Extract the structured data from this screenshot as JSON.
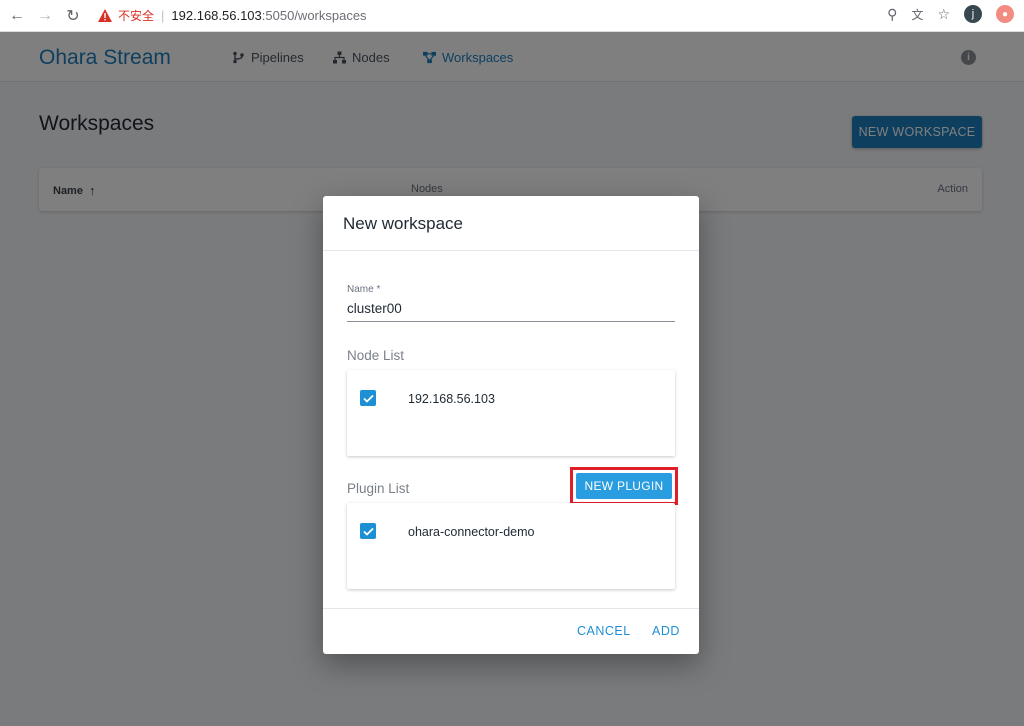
{
  "browser": {
    "insecure_label": "不安全",
    "url_host": "192.168.56.103",
    "url_rest": ":5050/workspaces",
    "profile_initial": "j"
  },
  "header": {
    "brand": "Ohara Stream",
    "nav": [
      {
        "label": "Pipelines",
        "icon": "pipeline-icon"
      },
      {
        "label": "Nodes",
        "icon": "nodes-icon"
      },
      {
        "label": "Workspaces",
        "icon": "workspaces-icon",
        "active": true
      }
    ],
    "info_icon": "info-icon"
  },
  "page": {
    "title": "Workspaces",
    "new_button": "NEW WORKSPACE",
    "table": {
      "columns": [
        "Name",
        "Nodes",
        "Action"
      ]
    }
  },
  "dialog": {
    "title": "New workspace",
    "name_label": "Name *",
    "name_value": "cluster00",
    "node_list_label": "Node List",
    "nodes": [
      "192.168.56.103"
    ],
    "plugin_list_label": "Plugin List",
    "new_plugin_button": "NEW PLUGIN",
    "plugins": [
      "ohara-connector-demo"
    ],
    "cancel": "CANCEL",
    "add": "ADD"
  },
  "colors": {
    "accent": "#1d7fbf",
    "checkbox": "#1d8fd4",
    "highlight_box": "#e11d2a"
  }
}
